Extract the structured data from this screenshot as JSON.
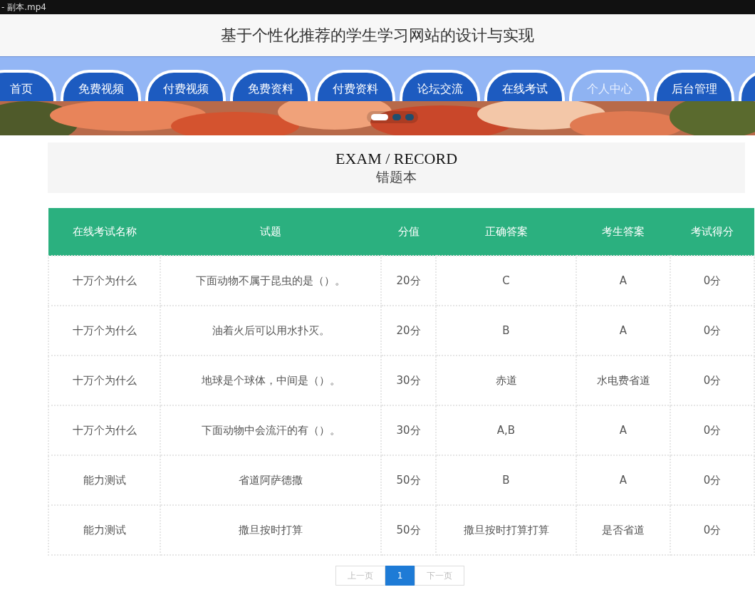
{
  "player_bar": {
    "title": "- 副本.mp4"
  },
  "site_title": "基于个性化推荐的学生学习网站的设计与实现",
  "nav": [
    {
      "label": "首页",
      "selected": false
    },
    {
      "label": "免费视频",
      "selected": false
    },
    {
      "label": "付费视频",
      "selected": false
    },
    {
      "label": "免费资料",
      "selected": false
    },
    {
      "label": "付费资料",
      "selected": false
    },
    {
      "label": "论坛交流",
      "selected": false
    },
    {
      "label": "在线考试",
      "selected": false
    },
    {
      "label": "个人中心",
      "selected": true
    },
    {
      "label": "后台管理",
      "selected": false
    },
    {
      "selected": false
    }
  ],
  "banner": {
    "kind": "picture",
    "slides": [
      {
        "selected": true
      },
      {
        "selected": false
      },
      {
        "selected": false
      }
    ]
  },
  "heading": {
    "title": "EXAM / RECORD",
    "subtitle": "错题本"
  },
  "table": {
    "columns": [
      "在线考试名称",
      "试题",
      "分值",
      "正确答案",
      "考生答案",
      "考试得分"
    ],
    "rows": [
      [
        "十万个为什么",
        "下面动物不属于昆虫的是（）。",
        "20分",
        "C",
        "A",
        "0分"
      ],
      [
        "十万个为什么",
        "油着火后可以用水扑灭。",
        "20分",
        "B",
        "A",
        "0分"
      ],
      [
        "十万个为什么",
        "地球是个球体，中间是（）。",
        "30分",
        "赤道",
        "水电费省道",
        "0分"
      ],
      [
        "十万个为什么",
        "下面动物中会流汗的有（）。",
        "30分",
        "A,B",
        "A",
        "0分"
      ],
      [
        "能力测试",
        "省道阿萨德撒",
        "50分",
        "B",
        "A",
        "0分"
      ],
      [
        "能力测试",
        "撒旦按时打算",
        "50分",
        "撒旦按时打算打算",
        "是否省道",
        "0分"
      ]
    ]
  },
  "pagination": [
    {
      "label": "上一页",
      "selected": false,
      "disabled": true
    },
    {
      "label": "1",
      "selected": true,
      "disabled": false
    },
    {
      "label": "下一页",
      "selected": false,
      "disabled": true
    }
  ]
}
